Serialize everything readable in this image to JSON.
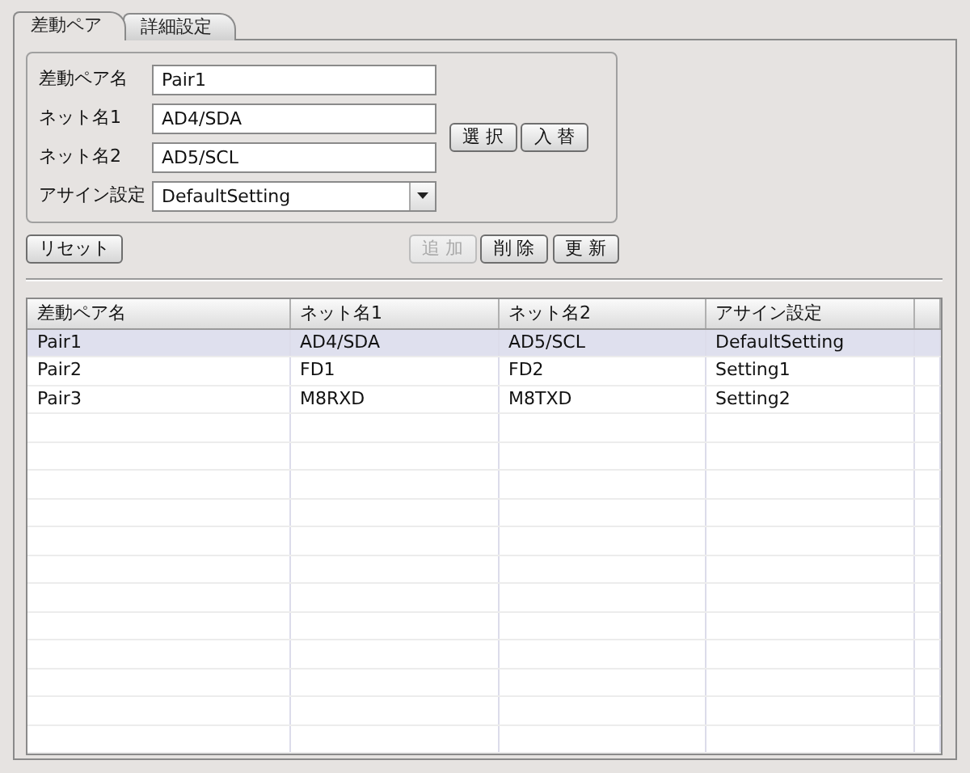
{
  "tabs": [
    {
      "label": "差動ペア",
      "selected": true
    },
    {
      "label": "詳細設定",
      "selected": false
    }
  ],
  "form": {
    "fields": [
      {
        "label": "差動ペア名",
        "value": "Pair1",
        "kind": "text"
      },
      {
        "label": "ネット名1",
        "value": "AD4/SDA",
        "kind": "text"
      },
      {
        "label": "ネット名2",
        "value": "AD5/SCL",
        "kind": "text"
      },
      {
        "label": "アサイン設定",
        "value": "DefaultSetting",
        "kind": "select"
      }
    ],
    "side_buttons": [
      "選 択",
      "入 替"
    ]
  },
  "reset_button": "リセット",
  "action_buttons": [
    {
      "label": "追 加",
      "disabled": true
    },
    {
      "label": "削 除",
      "disabled": false
    },
    {
      "label": "更 新",
      "disabled": false
    }
  ],
  "table": {
    "columns": [
      "差動ペア名",
      "ネット名1",
      "ネット名2",
      "アサイン設定"
    ],
    "rows": [
      {
        "cells": [
          "Pair1",
          "AD4/SDA",
          "AD5/SCL",
          "DefaultSetting"
        ],
        "selected": true
      },
      {
        "cells": [
          "Pair2",
          "FD1",
          "FD2",
          "Setting1"
        ],
        "selected": false
      },
      {
        "cells": [
          "Pair3",
          "M8RXD",
          "M8TXD",
          "Setting2"
        ],
        "selected": false
      }
    ]
  }
}
